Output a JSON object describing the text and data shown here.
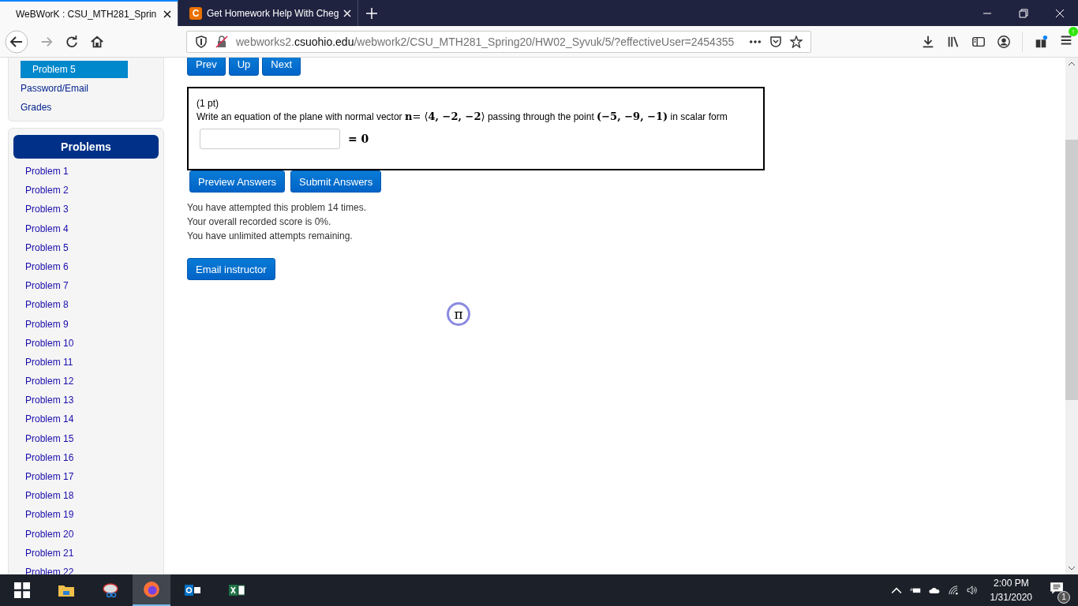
{
  "browser": {
    "tabs": [
      {
        "title": "WeBWorK : CSU_MTH281_Sprin",
        "kind": "page",
        "selected": true
      },
      {
        "title": "Get Homework Help With Cheg",
        "kind": "chegg",
        "selected": false
      }
    ],
    "favicon_letter": "C",
    "url": {
      "prefix": "webworks2.",
      "domain": "csuohio.edu",
      "path": "/webwork2/CSU_MTH281_Spring20/HW02_Syvuk/5/?effectiveUser=2454355"
    },
    "menu_badge": "↑"
  },
  "sidebar": {
    "nav": [
      {
        "label": "Problem 5",
        "selected": true
      },
      {
        "label": "Password/Email",
        "selected": false
      },
      {
        "label": "Grades",
        "selected": false
      }
    ],
    "problems_header": "Problems",
    "problems": [
      "Problem 1",
      "Problem 2",
      "Problem 3",
      "Problem 4",
      "Problem 5",
      "Problem 6",
      "Problem 7",
      "Problem 8",
      "Problem 9",
      "Problem 10",
      "Problem 11",
      "Problem 12",
      "Problem 13",
      "Problem 14",
      "Problem 15",
      "Problem 16",
      "Problem 17",
      "Problem 18",
      "Problem 19",
      "Problem 20",
      "Problem 21",
      "Problem 22"
    ]
  },
  "nav_buttons": [
    "Prev",
    "Up",
    "Next"
  ],
  "problem": {
    "points": "(1 pt)",
    "statement": [
      {
        "kind": "text",
        "text": "Write an equation of the plane with normal vector "
      },
      {
        "kind": "math",
        "text": "n"
      },
      {
        "kind": "math-light",
        "text": "= ⟨"
      },
      {
        "kind": "math",
        "text": "4, −2, −2"
      },
      {
        "kind": "math-light",
        "text": "⟩"
      },
      {
        "kind": "text",
        "text": " passing through the point "
      },
      {
        "kind": "math",
        "text": "(−5, −9, −1)"
      },
      {
        "kind": "text",
        "text": " in scalar form"
      }
    ],
    "answer": {
      "suffix": "= 0"
    }
  },
  "action_buttons": [
    "Preview Answers",
    "Submit Answers"
  ],
  "messages": [
    "You have attempted this problem 14 times.",
    "Your overall recorded score is 0%.",
    "You have unlimited attempts remaining."
  ],
  "email_button": "Email instructor",
  "mathjax_badge": "π",
  "taskbar": {
    "time": "2:00 PM",
    "date": "1/31/2020",
    "notifications": "1"
  }
}
